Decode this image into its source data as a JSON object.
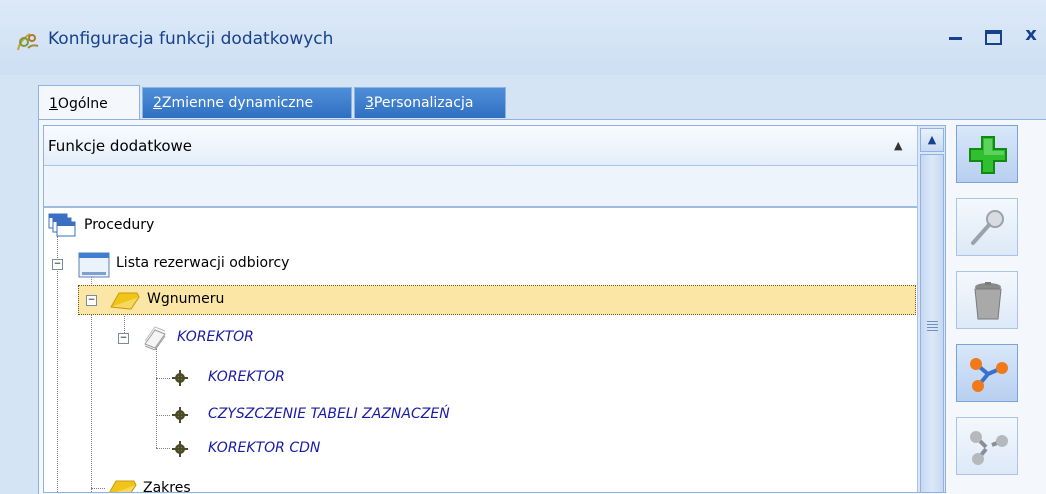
{
  "window": {
    "title": "Konfiguracja funkcji dodatkowych",
    "controls": [
      "–",
      "x"
    ]
  },
  "tabs": [
    {
      "num": "1",
      "label": "Ogólne",
      "active": true
    },
    {
      "num": "2",
      "label": "Zmienne dynamiczne",
      "active": false
    },
    {
      "num": "3",
      "label": "Personalizacja",
      "active": false
    }
  ],
  "grid": {
    "column_header": "Funkcje dodatkowe",
    "sort_indicator": "▲",
    "scroll_up": "▲"
  },
  "tree": [
    {
      "label": "Procedury",
      "icon": "procedures-icon"
    },
    {
      "label": "Lista rezerwacji odbiorcy",
      "icon": "window-list-icon",
      "expander": "−"
    },
    {
      "label": "Wgnumeru",
      "icon": "folder-icon",
      "expander": "−",
      "selected": true
    },
    {
      "label": "KOREKTOR",
      "icon": "document-stack-icon",
      "expander": "−"
    },
    {
      "label": "KOREKTOR",
      "icon": "gear-function-icon"
    },
    {
      "label": "CZYSZCZENIE TABELI ZAZNACZEŃ",
      "icon": "gear-function-icon"
    },
    {
      "label": "KOREKTOR CDN",
      "icon": "gear-function-icon"
    },
    {
      "label": "Zakres",
      "icon": "folder-icon"
    }
  ],
  "toolbar": [
    {
      "name": "add-button",
      "icon": "plus-icon",
      "active": true
    },
    {
      "name": "edit-button",
      "icon": "magnifier-icon",
      "active": false
    },
    {
      "name": "delete-button",
      "icon": "trash-icon",
      "active": false
    },
    {
      "name": "link-button",
      "icon": "link-icon",
      "active": true
    },
    {
      "name": "unlink-button",
      "icon": "unlink-icon",
      "active": false
    }
  ],
  "colors": {
    "accent": "#15428b",
    "tab_blue": "#2f6fc2",
    "selected_row": "#fbe6a5",
    "italic_text": "#1a1aa8"
  }
}
